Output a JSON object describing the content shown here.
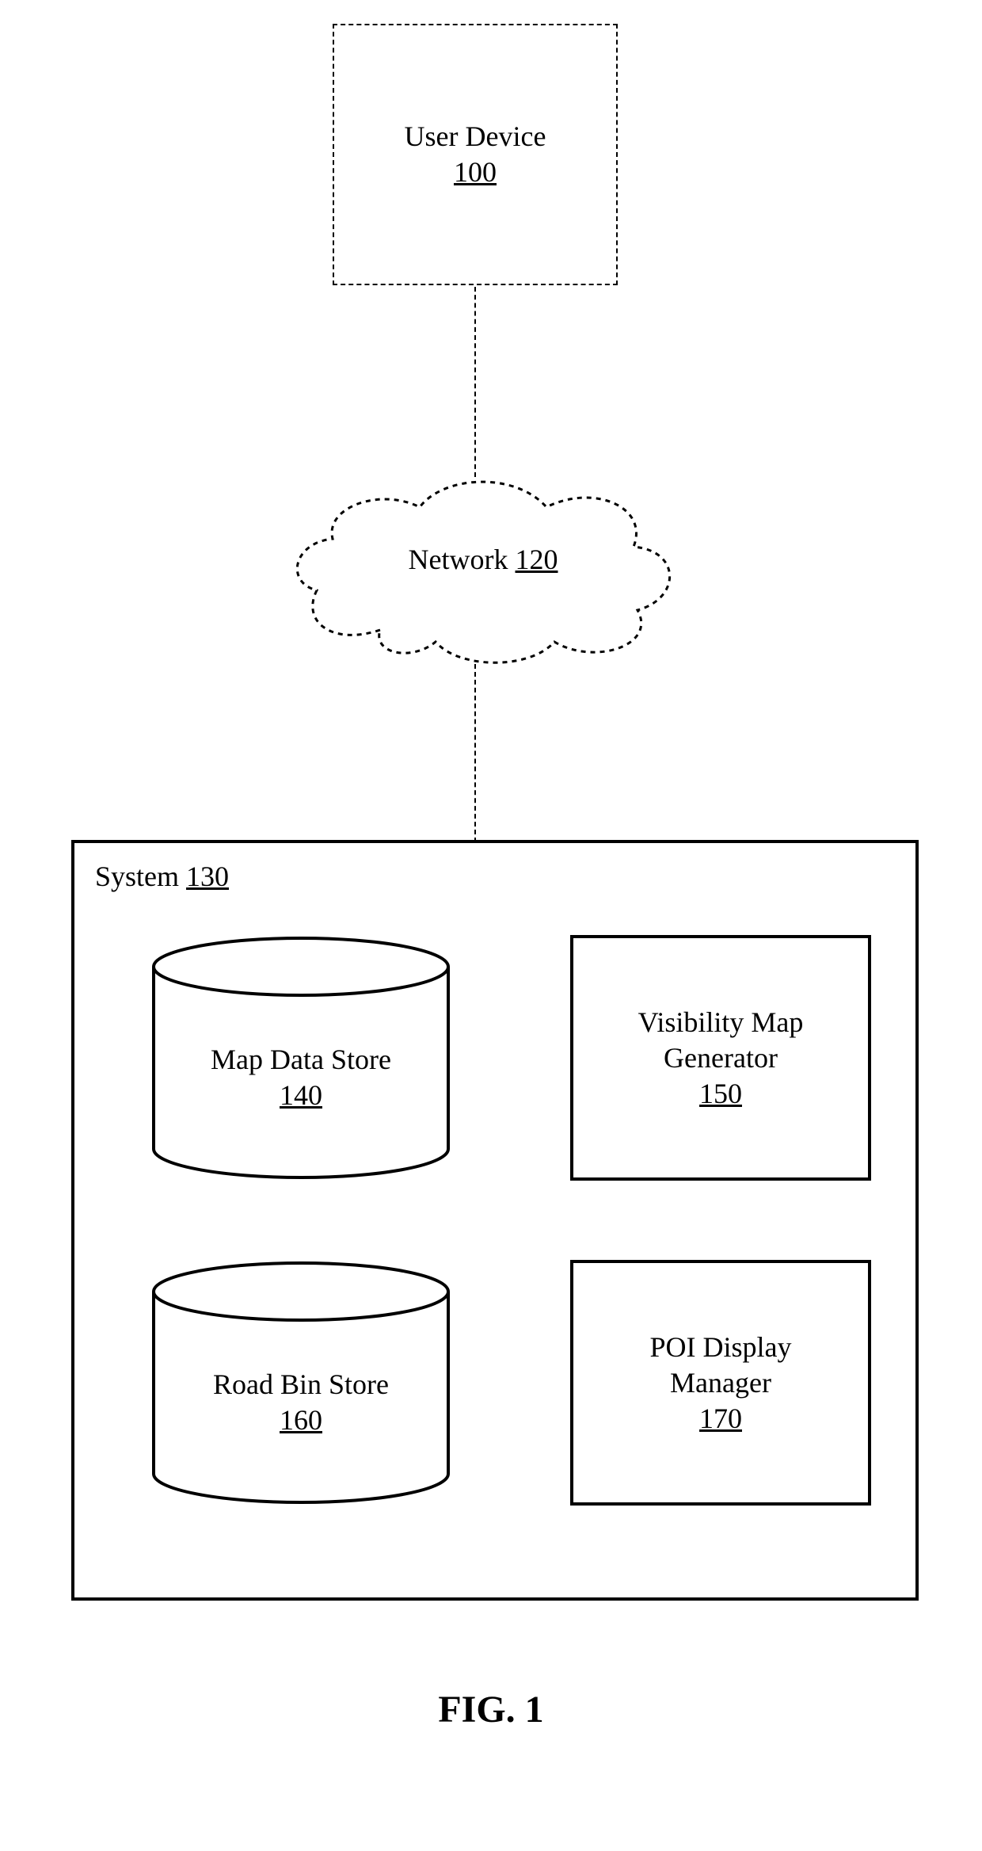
{
  "figure_label": "FIG. 1",
  "user_device": {
    "label": "User Device",
    "ref": "100"
  },
  "network": {
    "label": "Network",
    "ref": "120"
  },
  "system": {
    "label": "System",
    "ref": "130"
  },
  "components": {
    "map_data_store": {
      "label": "Map Data Store",
      "ref": "140"
    },
    "visibility_map_generator": {
      "line1": "Visibility Map",
      "line2": "Generator",
      "ref": "150"
    },
    "road_bin_store": {
      "label": "Road Bin Store",
      "ref": "160"
    },
    "poi_display_manager": {
      "line1": "POI Display",
      "line2": "Manager",
      "ref": "170"
    }
  }
}
